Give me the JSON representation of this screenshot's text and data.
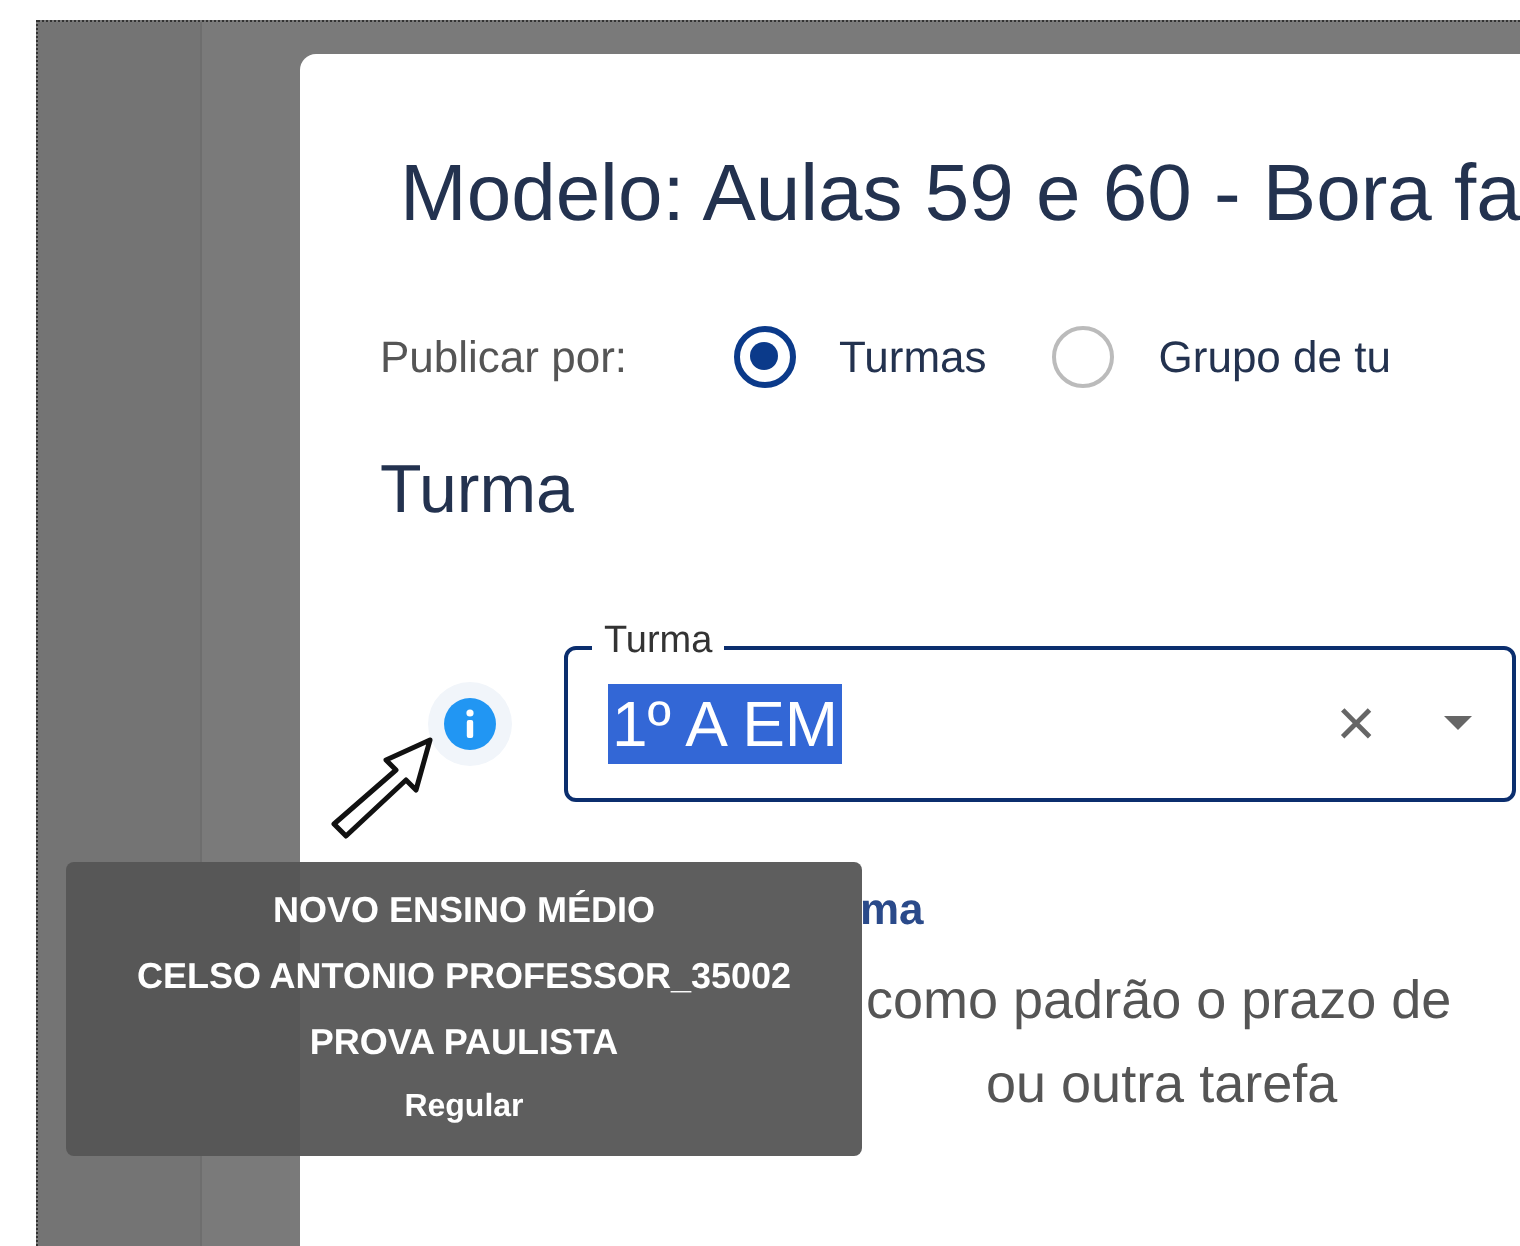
{
  "modal": {
    "title": "Modelo: Aulas 59 e 60 - Bora fa",
    "publish": {
      "label": "Publicar por:",
      "options": [
        {
          "label": "Turmas",
          "selected": true
        },
        {
          "label": "Grupo de tu",
          "selected": false
        }
      ]
    },
    "section_title": "Turma",
    "class_field": {
      "label": "Turma",
      "value": "1º A EM",
      "value_selected": true,
      "clear": "×"
    },
    "add_link": "ma",
    "notice": [
      "como padrão o prazo de",
      "ou outra tarefa"
    ]
  },
  "tooltip": {
    "lines": [
      "NOVO ENSINO MÉDIO",
      "CELSO ANTONIO PROFESSOR_35002",
      "PROVA PAULISTA",
      "Regular"
    ]
  }
}
